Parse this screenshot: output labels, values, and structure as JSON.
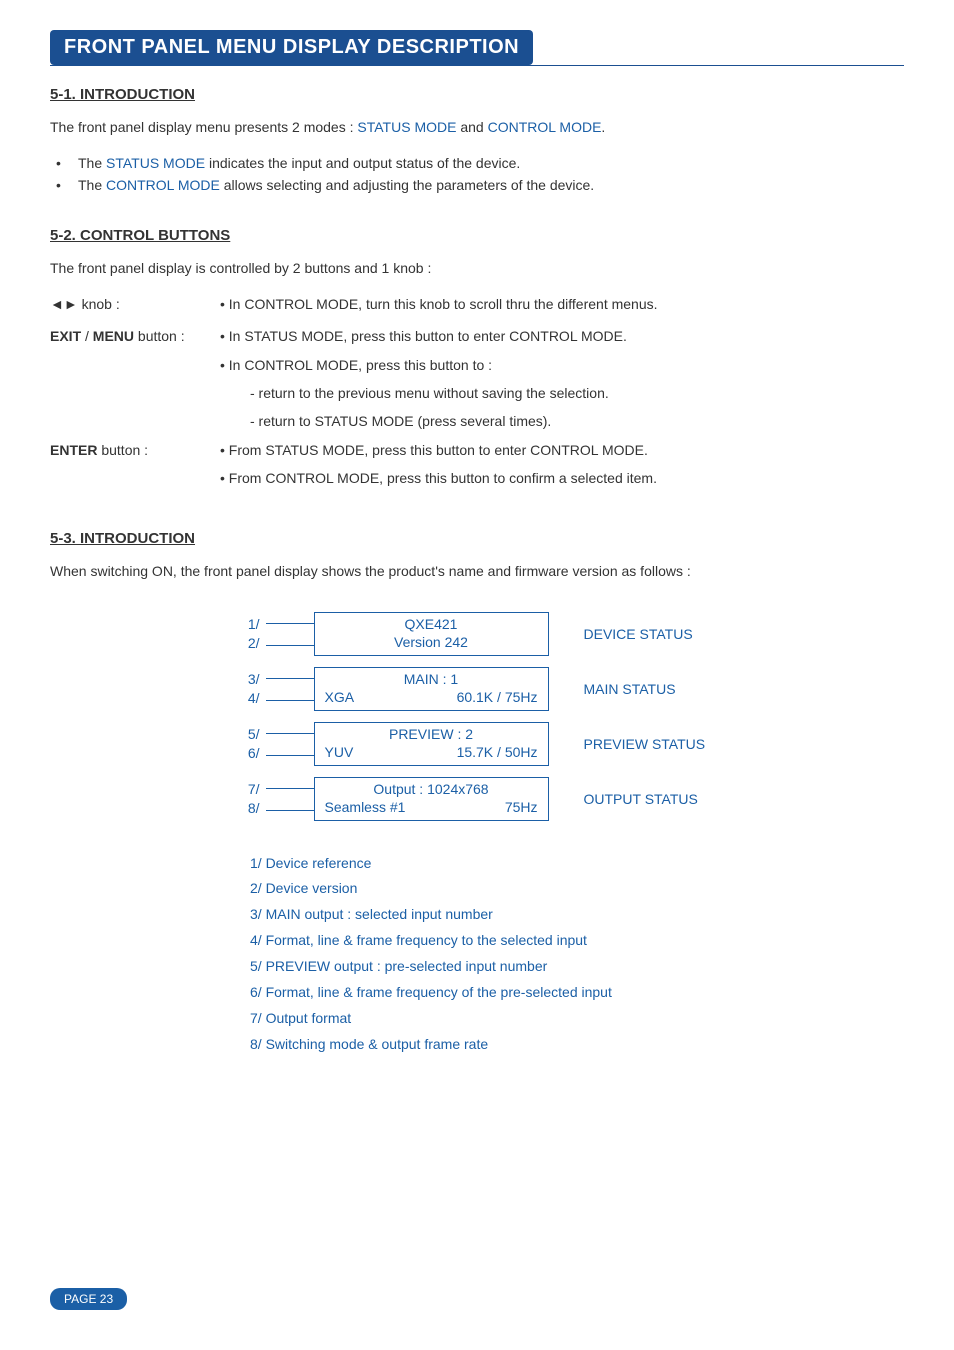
{
  "title_banner": "FRONT PANEL MENU DISPLAY DESCRIPTION",
  "sec1": {
    "heading": "5-1. INTRODUCTION",
    "intro_pre": "The front panel display menu presents 2 modes : ",
    "mode1": "STATUS MODE",
    "intro_mid": " and ",
    "mode2": "CONTROL MODE",
    "intro_post": ".",
    "b1_pre": "The ",
    "b1_blue": "STATUS MODE",
    "b1_post": " indicates the input and output status of the device.",
    "b2_pre": "The ",
    "b2_blue": "CONTROL MODE",
    "b2_post": " allows selecting and adjusting the parameters of the device."
  },
  "sec2": {
    "heading": "5-2. CONTROL BUTTONS",
    "intro": "The front panel display is controlled by 2 buttons and 1 knob :",
    "knob_label": "◄► knob :",
    "knob_desc": "• In CONTROL MODE, turn this knob to scroll thru the different menus.",
    "exitmenu_label_b1": "EXIT",
    "exitmenu_label_mid": " / ",
    "exitmenu_label_b2": "MENU",
    "exitmenu_label_post": " button :",
    "exitmenu_d1": "• In STATUS MODE, press this button to enter CONTROL MODE.",
    "exitmenu_d2": "• In CONTROL MODE, press this button to :",
    "exitmenu_d3": "- return to the previous menu without saving the selection.",
    "exitmenu_d4": "- return to STATUS MODE (press several times).",
    "enter_label_b": "ENTER",
    "enter_label_post": " button :",
    "enter_d1": "• From STATUS MODE, press this button to enter CONTROL MODE.",
    "enter_d2": "• From CONTROL MODE, press this button to confirm a selected item."
  },
  "sec3": {
    "heading": "5-3. INTRODUCTION",
    "intro": "When switching ON, the front panel display shows the product's name and firmware version as follows :"
  },
  "diagram": {
    "r1": {
      "n1": "1/",
      "n2": "2/",
      "l1": "QXE421",
      "l2": "Version 242",
      "side": "DEVICE STATUS"
    },
    "r2": {
      "n1": "3/",
      "n2": "4/",
      "l1": "MAIN : 1",
      "l2a": "XGA",
      "l2b": "60.1K / 75Hz",
      "side": "MAIN STATUS"
    },
    "r3": {
      "n1": "5/",
      "n2": "6/",
      "l1": "PREVIEW : 2",
      "l2a": "YUV",
      "l2b": "15.7K / 50Hz",
      "side": "PREVIEW STATUS"
    },
    "r4": {
      "n1": "7/",
      "n2": "8/",
      "l1": "Output : 1024x768",
      "l2a": "Seamless #1",
      "l2b": "75Hz",
      "side": "OUTPUT STATUS"
    }
  },
  "legend": {
    "l1": "1/ Device reference",
    "l2": "2/ Device version",
    "l3": "3/ MAIN output : selected input number",
    "l4": "4/ Format, line & frame frequency to the selected input",
    "l5": "5/ PREVIEW output : pre-selected input number",
    "l6": "6/ Format, line & frame frequency of the pre-selected input",
    "l7": "7/ Output format",
    "l8": "8/ Switching mode & output frame rate"
  },
  "page_badge": "PAGE 23"
}
